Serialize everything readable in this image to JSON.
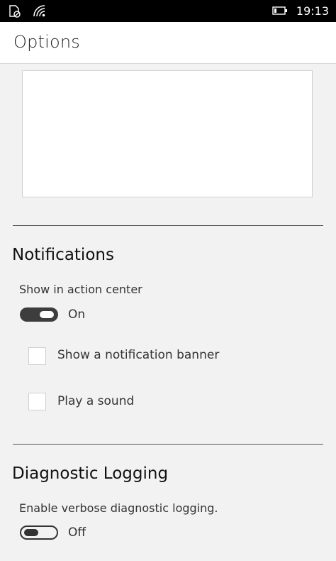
{
  "status_bar": {
    "icons": [
      "message-status-icon",
      "wifi-icon",
      "battery-icon"
    ],
    "time": "19:13"
  },
  "header": {
    "title": "Options"
  },
  "notifications": {
    "title": "Notifications",
    "show_in_action_center_label": "Show in action center",
    "toggle_state": "On",
    "toggle_on": true,
    "options": [
      {
        "label": "Show a notification banner",
        "checked": false
      },
      {
        "label": "Play a sound",
        "checked": false
      }
    ]
  },
  "diagnostic_logging": {
    "title": "Diagnostic Logging",
    "verbose_label": "Enable verbose diagnostic logging.",
    "toggle_state": "Off",
    "toggle_on": false
  },
  "colors": {
    "status_bar_bg": "#000000",
    "page_bg": "#f2f2f2",
    "header_bg": "#ffffff",
    "toggle_on": "#3d3d3d"
  }
}
